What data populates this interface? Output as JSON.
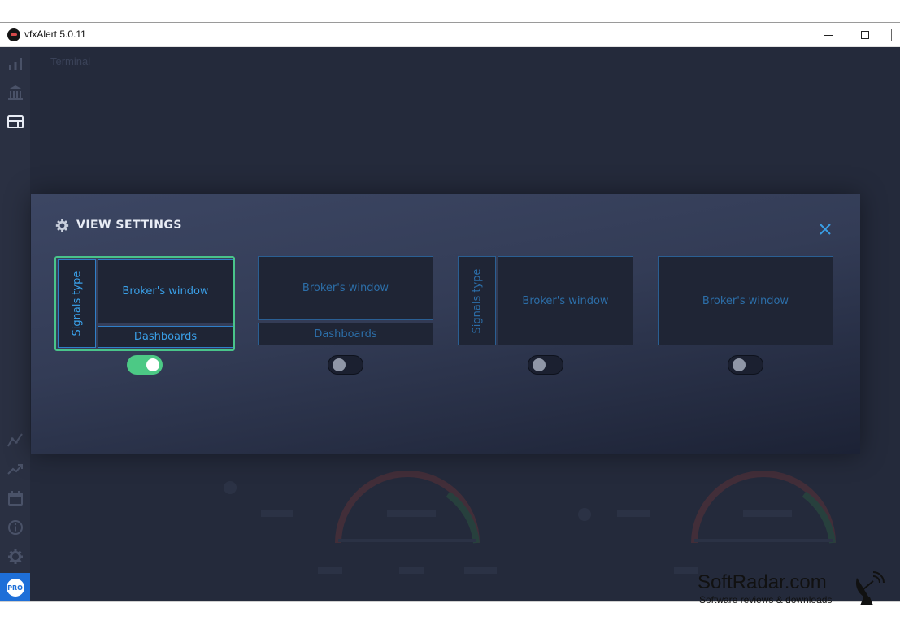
{
  "window": {
    "title": "vfxAlert 5.0.11"
  },
  "page": {
    "title": "Terminal"
  },
  "sidebar": {
    "top_items": [
      {
        "icon": "bar-chart-icon"
      },
      {
        "icon": "bank-icon"
      },
      {
        "icon": "layout-icon",
        "active": true
      }
    ],
    "bottom_items": [
      {
        "icon": "line-chart-icon"
      },
      {
        "icon": "trending-up-icon"
      },
      {
        "icon": "calendar-icon"
      },
      {
        "icon": "info-icon"
      },
      {
        "icon": "gear-icon"
      }
    ],
    "pro_label": "PRO"
  },
  "modal": {
    "title": "VIEW SETTINGS",
    "options": [
      {
        "signals_label": "Signals type",
        "broker_label": "Broker's window",
        "dashboards_label": "Dashboards",
        "enabled": true
      },
      {
        "broker_label": "Broker's window",
        "dashboards_label": "Dashboards",
        "enabled": false
      },
      {
        "signals_label": "Signals type",
        "broker_label": "Broker's window",
        "enabled": false
      },
      {
        "broker_label": "Broker's window",
        "enabled": false
      }
    ]
  },
  "watermark": {
    "name": "SoftRadar.com",
    "tagline": "Software reviews & downloads"
  },
  "colors": {
    "accent_blue": "#3aa0e8",
    "toggle_on": "#4cc985",
    "selected_border": "#49c48a",
    "pro_blue": "#1e6fd8"
  }
}
